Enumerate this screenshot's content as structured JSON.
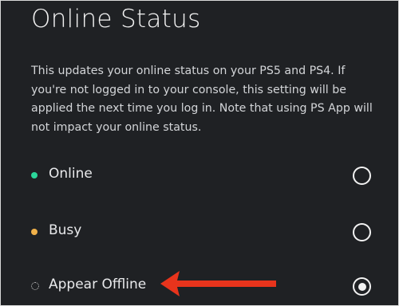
{
  "page": {
    "title": "Online Status",
    "description": "This updates your online status on your PS5 and PS4. If you're not logged in to your console, this setting will be applied the next time you log in. Note that using PS App will not impact your online status."
  },
  "options": [
    {
      "label": "Online",
      "status_color": "#2bd69a",
      "selected": false
    },
    {
      "label": "Busy",
      "status_color": "#f0b14a",
      "selected": false
    },
    {
      "label": "Appear Offline",
      "status_color": "#d0d0d0",
      "selected": true
    }
  ],
  "annotation": {
    "arrow_icon": "arrow-left-icon",
    "arrow_color": "#e8341c"
  },
  "colors": {
    "background": "#1f2124",
    "text": "#e8e9eb"
  }
}
